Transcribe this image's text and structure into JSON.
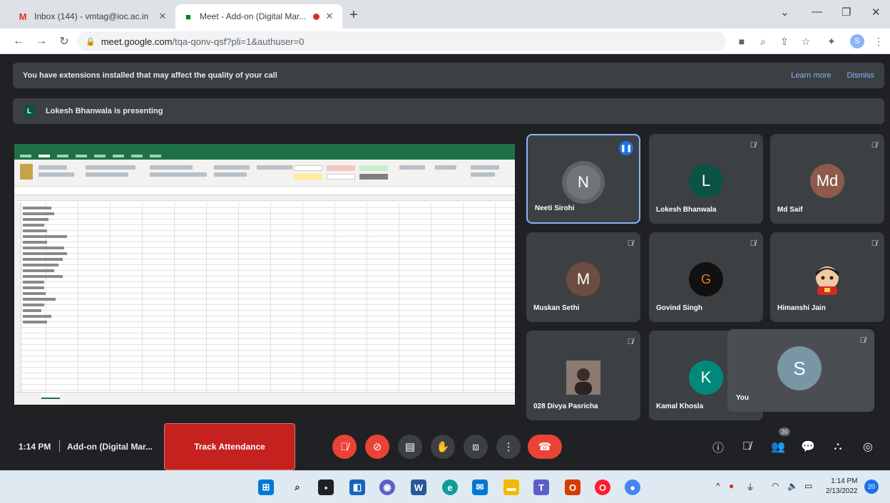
{
  "browser": {
    "tabs": [
      {
        "title": "Inbox (144) - vmtag@ioc.ac.in",
        "icon": "gmail-icon"
      },
      {
        "title": "Meet - Add-on (Digital Mar...",
        "icon": "meet-icon"
      }
    ],
    "url_host": "meet.google.com",
    "url_path": "/tqa-qonv-qsf?pli=1&authuser=0",
    "profile_initial": "S"
  },
  "banner": {
    "message": "You have extensions installed that may affect the quality of your call",
    "learn_more": "Learn more",
    "dismiss": "Dismiss"
  },
  "presenting": {
    "badge": "L",
    "text": "Lokesh Bhanwala is presenting"
  },
  "participants": [
    {
      "name": "Neeti Sirohi",
      "initial": "N",
      "color": "#707579",
      "speaking": true
    },
    {
      "name": "Lokesh Bhanwala",
      "initial": "L",
      "color": "#0b5345"
    },
    {
      "name": "Md Saif",
      "initial": "Md",
      "color": "#8d5a4b"
    },
    {
      "name": "Muskan Sethi",
      "initial": "M",
      "color": "#6d4c41"
    },
    {
      "name": "Govind Singh",
      "initial": "G",
      "color": "#111111"
    },
    {
      "name": "Himanshi Jain",
      "initial": "",
      "color": "#3c4043"
    },
    {
      "name": "028 Divya Pasricha",
      "initial": "",
      "color": "#6b5b53"
    },
    {
      "name": "Kamal Khosla",
      "initial": "K",
      "color": "#00897b"
    }
  ],
  "self": {
    "name": "You",
    "initial": "S"
  },
  "controls": {
    "time": "1:14 PM",
    "meeting_name": "Add-on (Digital Mar...",
    "track_attendance": "Track Attendance",
    "participant_count": "20"
  },
  "taskbar": {
    "time": "1:14 PM",
    "date": "2/13/2022",
    "notification_count": "20"
  }
}
